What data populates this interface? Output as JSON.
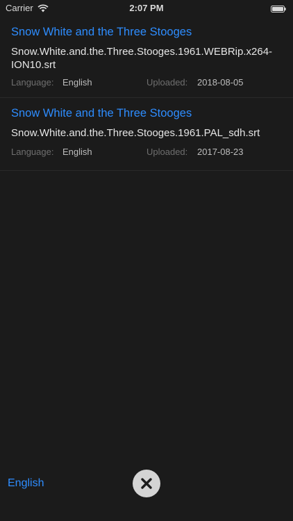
{
  "status_bar": {
    "carrier": "Carrier",
    "time": "2:07 PM",
    "icons": [
      "wifi-icon",
      "battery-icon"
    ]
  },
  "subtitles": [
    {
      "title": "Snow White and the Three Stooges",
      "filename": "Snow.White.and.the.Three.Stooges.1961.WEBRip.x264-ION10.srt",
      "language_label": "Language:",
      "language": "English",
      "uploaded_label": "Uploaded:",
      "uploaded": "2018-08-05"
    },
    {
      "title": "Snow White and the Three Stooges",
      "filename": "Snow.White.and.the.Three.Stooges.1961.PAL_sdh.srt",
      "language_label": "Language:",
      "language": "English",
      "uploaded_label": "Uploaded:",
      "uploaded": "2017-08-23"
    }
  ],
  "footer": {
    "language": "English",
    "close_icon": "close-icon"
  },
  "colors": {
    "background": "#1b1b1b",
    "accent": "#2e8dff",
    "close_button_bg": "#d4d4d4"
  }
}
